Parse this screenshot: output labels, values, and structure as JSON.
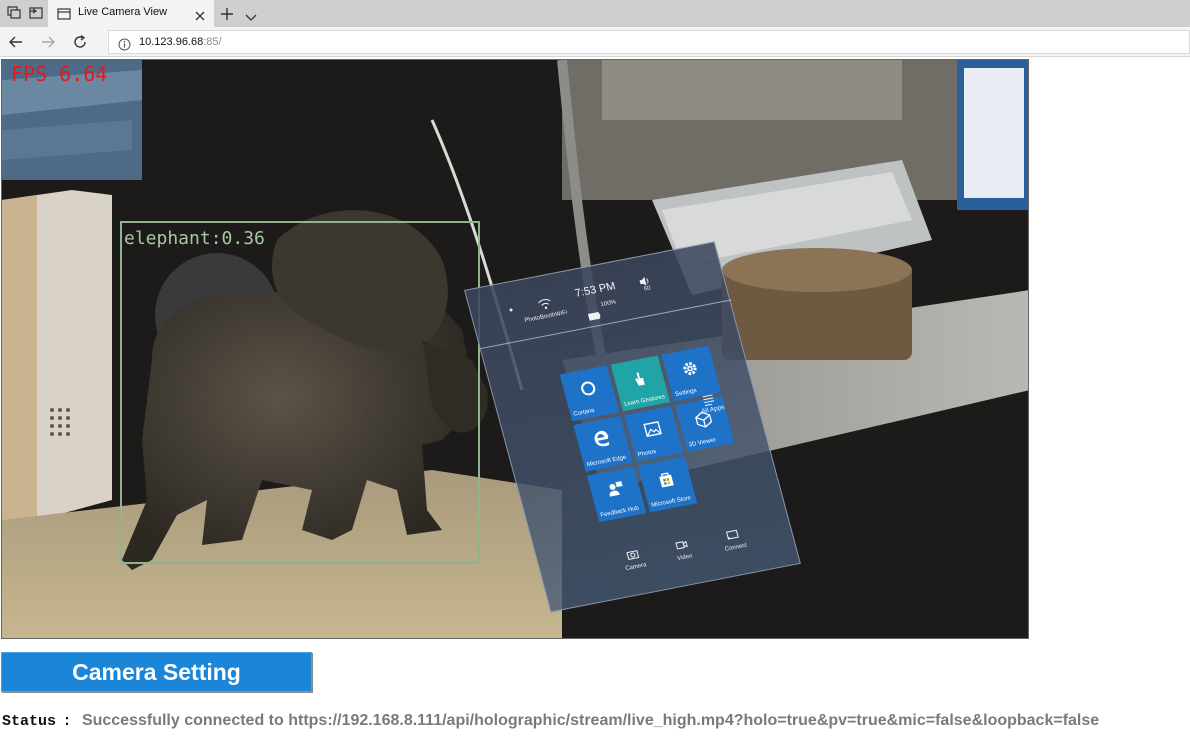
{
  "browser": {
    "tab_title": "Live Camera View",
    "url_host": "10.123.96.68",
    "url_port_path": ":85/",
    "icons": [
      "tab-actions-icon",
      "tab-aside-icon",
      "page-icon",
      "close-icon",
      "new-tab-icon",
      "tab-menu-icon",
      "back-icon",
      "forward-icon",
      "refresh-icon",
      "info-icon"
    ]
  },
  "camera": {
    "fps_text": "FPS 6.64",
    "detection": {
      "label": "elephant:0.36",
      "box_color": "#8fb58e"
    },
    "hologram": {
      "status": {
        "wifi_label": "PhotoBoothWiFi",
        "time": "7:53 PM",
        "battery_label": "100%",
        "volume_label": "50"
      },
      "tiles": [
        {
          "label": "Cortana",
          "icon": "cortana-icon"
        },
        {
          "label": "Learn Gestures",
          "icon": "hand-icon"
        },
        {
          "label": "Settings",
          "icon": "gear-icon"
        },
        {
          "label": "Microsoft Edge",
          "icon": "edge-icon"
        },
        {
          "label": "Photos",
          "icon": "photos-icon"
        },
        {
          "label": "3D Viewer",
          "icon": "cube-icon"
        },
        {
          "label": "Feedback Hub",
          "icon": "feedback-icon"
        },
        {
          "label": "Microsoft Store",
          "icon": "store-icon"
        }
      ],
      "all_apps_label": "All Apps",
      "bottom": [
        {
          "label": "Camera",
          "icon": "camera-icon"
        },
        {
          "label": "Video",
          "icon": "video-icon"
        },
        {
          "label": "Connect",
          "icon": "connect-icon"
        }
      ]
    },
    "colors": {
      "fps": "#e01b1b",
      "tile": "#1e72c8",
      "tile_active": "#20a4a6"
    }
  },
  "controls": {
    "camera_setting_label": "Camera Setting",
    "button_color": "#1b86d8"
  },
  "status": {
    "label": "Status",
    "separator": ":",
    "text": "Successfully connected to https://192.168.8.111/api/holographic/stream/live_high.mp4?holo=true&pv=true&mic=false&loopback=false"
  }
}
